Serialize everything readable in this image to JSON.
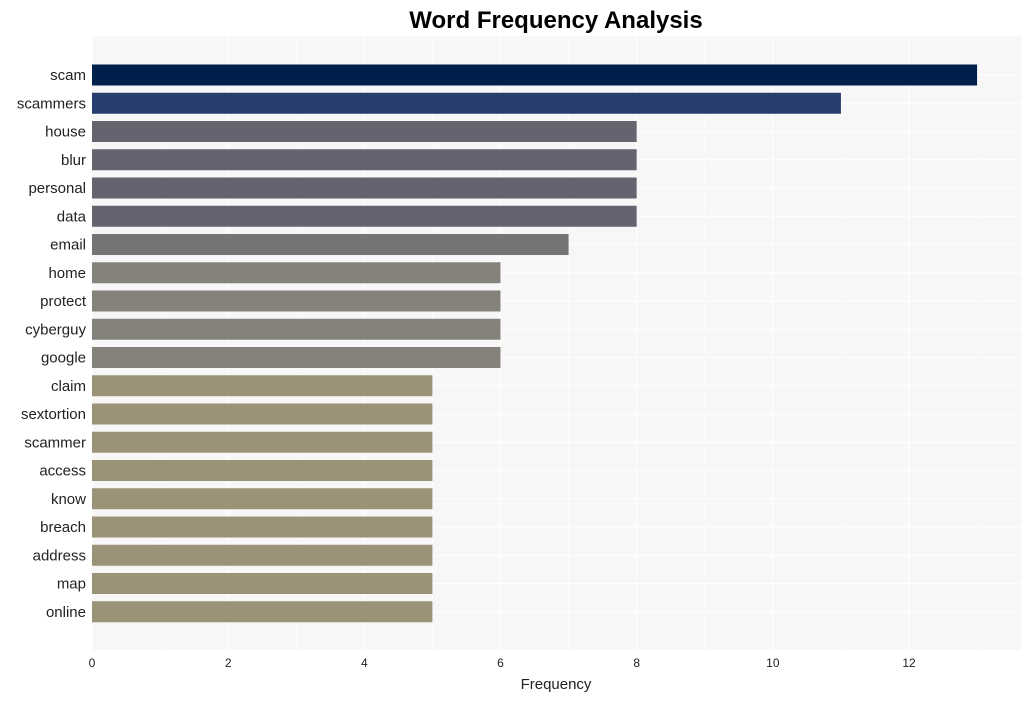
{
  "chart_data": {
    "type": "bar",
    "orientation": "horizontal",
    "title": "Word Frequency Analysis",
    "xlabel": "Frequency",
    "ylabel": "",
    "xlim": [
      0,
      13.65
    ],
    "xticks": [
      0,
      2,
      4,
      6,
      8,
      10,
      12
    ],
    "grid": true,
    "legend": "none",
    "categories": [
      "scam",
      "scammers",
      "house",
      "blur",
      "personal",
      "data",
      "email",
      "home",
      "protect",
      "cyberguy",
      "google",
      "claim",
      "sextortion",
      "scammer",
      "access",
      "know",
      "breach",
      "address",
      "map",
      "online"
    ],
    "values": [
      13,
      11,
      8,
      8,
      8,
      8,
      7,
      6,
      6,
      6,
      6,
      5,
      5,
      5,
      5,
      5,
      5,
      5,
      5,
      5
    ],
    "colors": [
      "#00204c",
      "#273d6e",
      "#63646f",
      "#63646f",
      "#63646f",
      "#63646f",
      "#747474",
      "#84827a",
      "#84827a",
      "#84827a",
      "#84827a",
      "#9a9377",
      "#9a9377",
      "#9a9377",
      "#9a9377",
      "#9a9377",
      "#9a9377",
      "#9a9377",
      "#9a9377",
      "#9a9377"
    ],
    "background": "#f7f7f7"
  }
}
